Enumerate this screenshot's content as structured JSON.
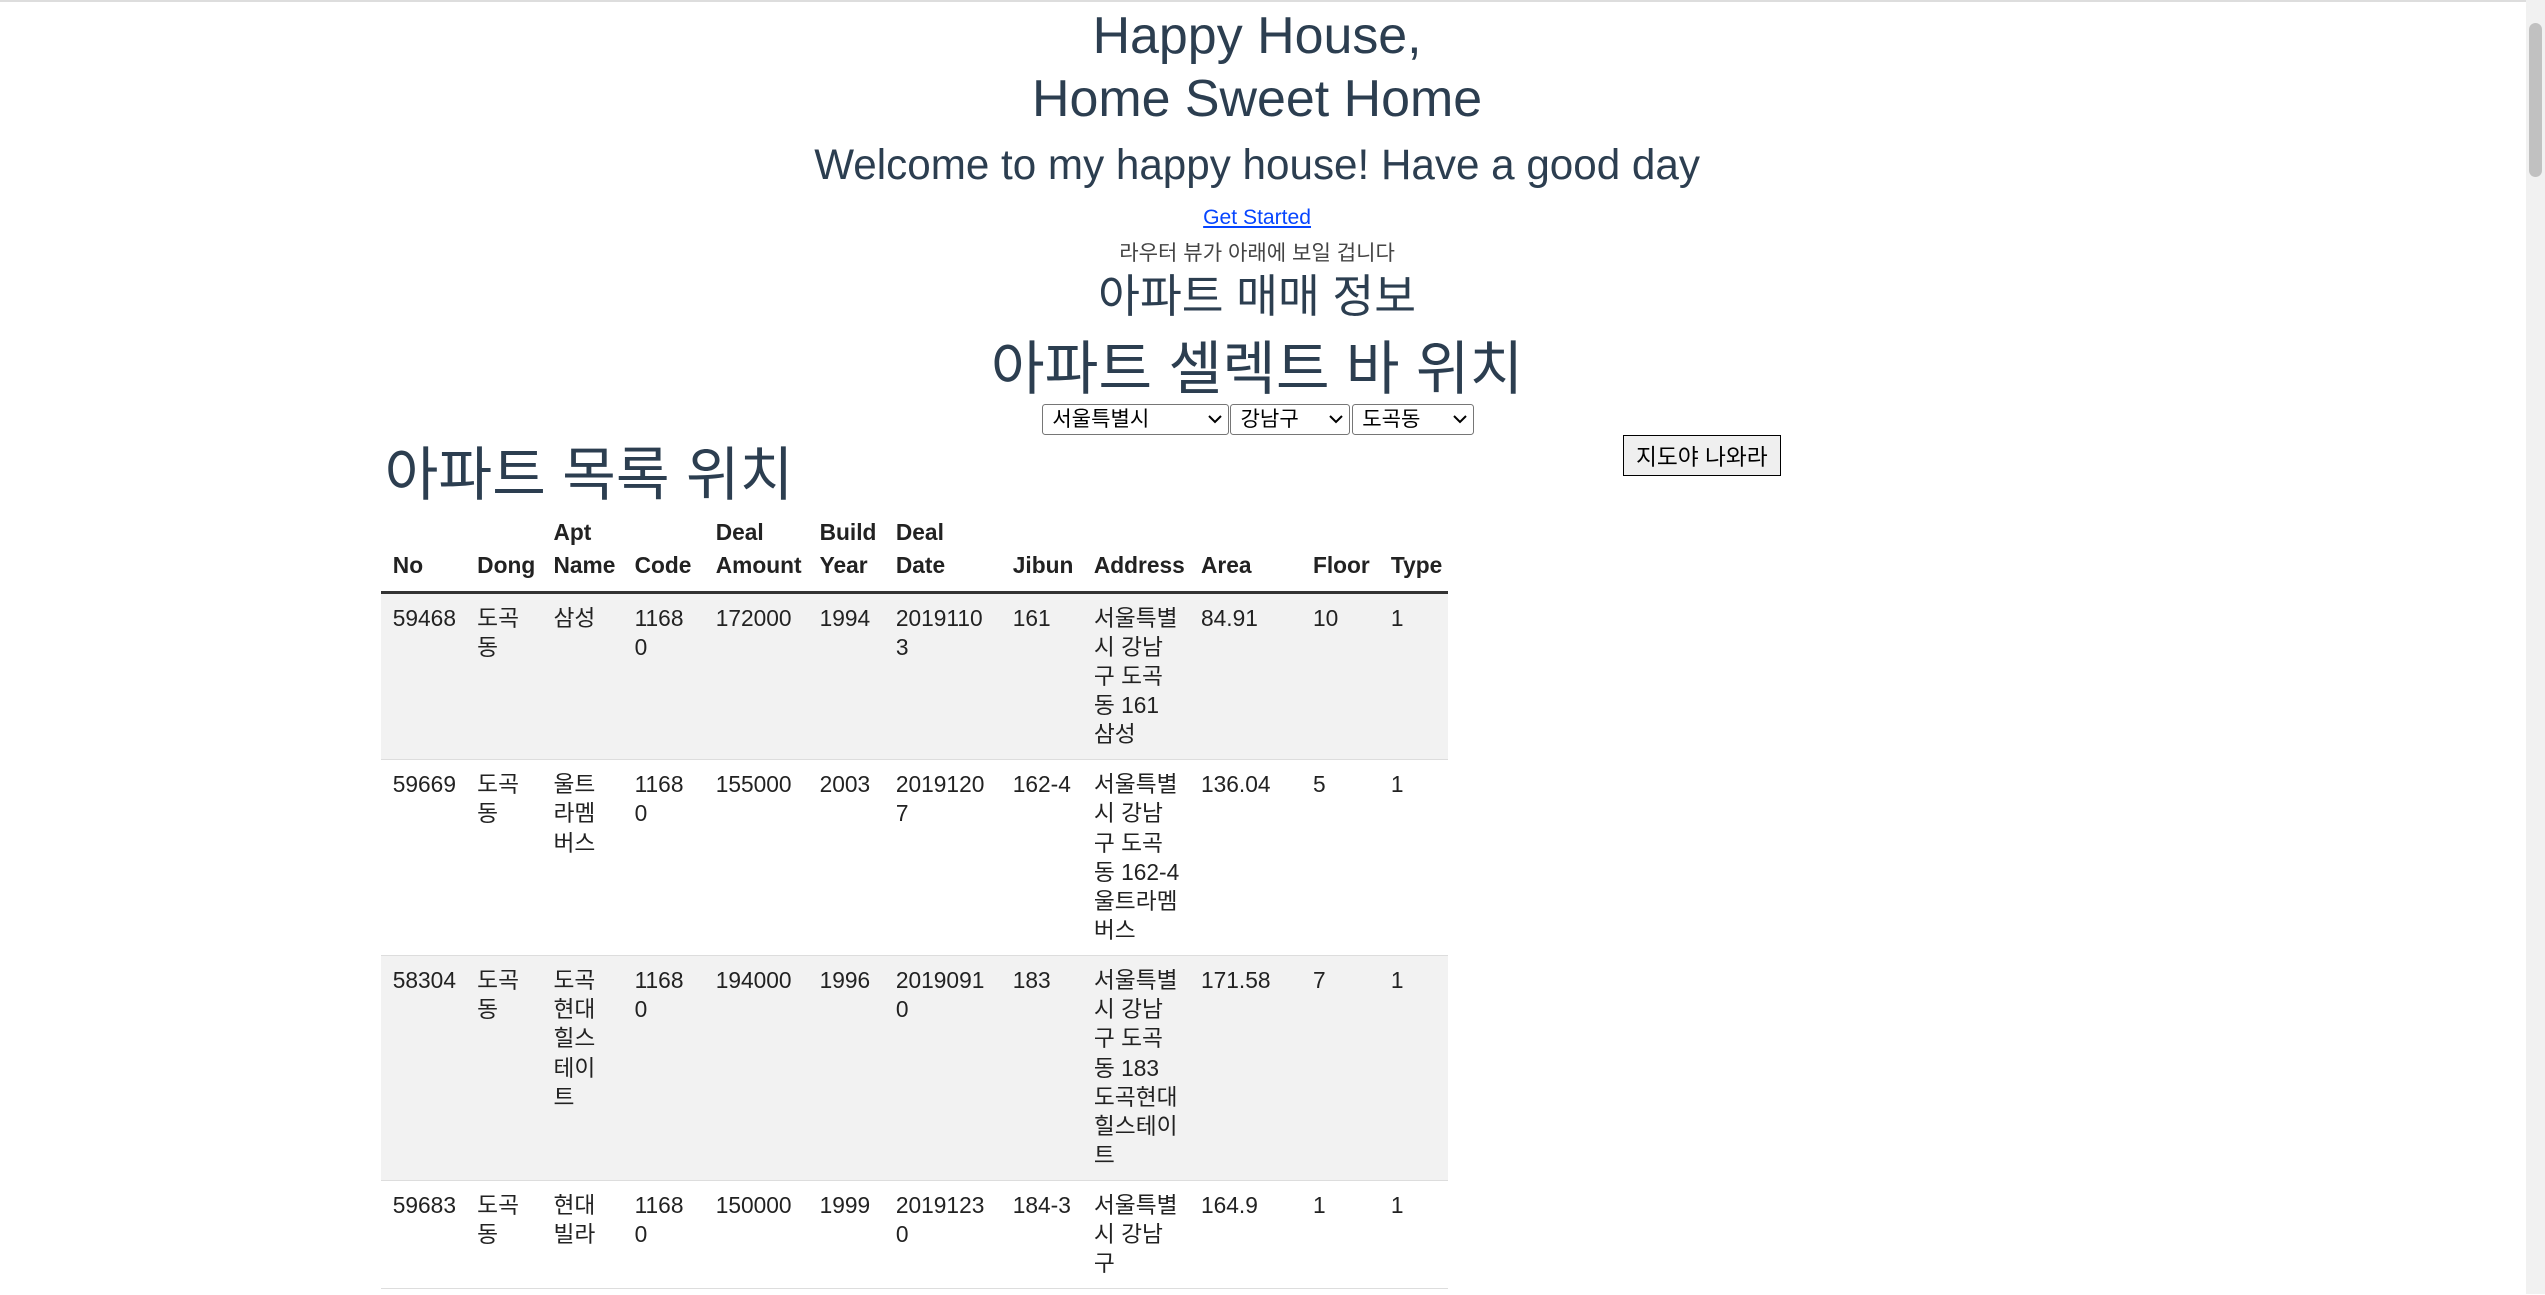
{
  "header": {
    "title_line1": "Happy House,",
    "title_line2": "Home Sweet Home",
    "welcome": "Welcome to my happy house! Have a good day",
    "get_started": "Get Started",
    "router_note": "라우터 뷰가 아래에 보일 겁니다"
  },
  "section": {
    "title": "아파트 매매 정보",
    "select_bar_title": "아파트 셀렉트 바 위치",
    "list_title": "아파트 목록 위치",
    "map_button": "지도야 나와라"
  },
  "selects": {
    "city": "서울특별시",
    "gu": "강남구",
    "dong": "도곡동"
  },
  "table": {
    "columns": [
      "No",
      "Dong",
      "Apt Name",
      "Code",
      "Deal Amount",
      "Build Year",
      "Deal Date",
      "Jibun",
      "Address",
      "Area",
      "Floor",
      "Type"
    ],
    "rows": [
      [
        "59468",
        "도곡동",
        "삼성",
        "11680",
        "172000",
        "1994",
        "20191103",
        "161",
        "서울특별시 강남구 도곡동 161 삼성",
        "84.91",
        "10",
        "1"
      ],
      [
        "59669",
        "도곡동",
        "울트라멤버스",
        "11680",
        "155000",
        "2003",
        "20191207",
        "162-4",
        "서울특별시 강남구 도곡동 162-4 울트라멤버스",
        "136.04",
        "5",
        "1"
      ],
      [
        "58304",
        "도곡동",
        "도곡현대힐스테이트",
        "11680",
        "194000",
        "1996",
        "20190910",
        "183",
        "서울특별시 강남구 도곡동 183 도곡현대힐스테이트",
        "171.58",
        "7",
        "1"
      ],
      [
        "59683",
        "도곡동",
        "현대빌라",
        "11680",
        "150000",
        "1999",
        "20191230",
        "184-3",
        "서울특별시 강남구",
        "164.9",
        "1",
        "1"
      ]
    ]
  }
}
